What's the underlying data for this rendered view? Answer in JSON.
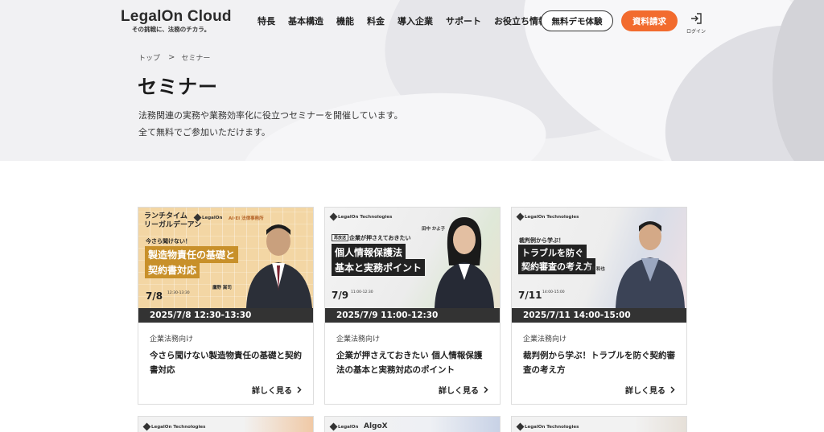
{
  "header": {
    "logo_main": "LegalOn Cloud",
    "logo_tagline": "その挑戦に、法務のチカラ。",
    "nav": [
      "特長",
      "基本構造",
      "機能",
      "料金",
      "導入企業",
      "サポート",
      "お役立ち情報"
    ],
    "demo_button": "無料デモ体験",
    "doc_button": "資料請求",
    "login_label": "ログイン"
  },
  "breadcrumb": {
    "home": "トップ",
    "separator": ">",
    "current": "セミナー"
  },
  "page": {
    "title": "セミナー",
    "desc_line1": "法務関連の実務や業務効率化に役立つセミナーを開催しています。",
    "desc_line2": "全て無料でご参加いただけます。"
  },
  "cards": [
    {
      "date": "2025/7/8 12:30-13:30",
      "category": "企業法務向け",
      "title": "今さら聞けない製造物責任の基礎と契約書対応",
      "more": "詳しく見る",
      "thumb": {
        "series": "ランチタイム\nリーガルデーアン",
        "logo": "LegalOn",
        "partner": "AI·EI 法律事務所",
        "lead": "今さら聞けない！",
        "line1": "製造物責任の基礎と",
        "line2": "契約書対応",
        "date": "7/8",
        "time": "12:30-13:30",
        "speaker": "鷹野 嵩司"
      }
    },
    {
      "date": "2025/7/9 11:00-12:30",
      "category": "企業法務向け",
      "title": "企業が押さえておきたい 個人情報保護法の基本と実務対応のポイント",
      "more": "詳しく見る",
      "thumb": {
        "logo": "LegalOn Technologies",
        "tag": "再放送",
        "lead": "企業が押さえておきたい",
        "line1": "個人情報保護法",
        "line2": "基本と実務ポイント",
        "date": "7/9",
        "time": "11:00-12:30",
        "speaker": "田中 かよ子"
      }
    },
    {
      "date": "2025/7/11 14:00-15:00",
      "category": "企業法務向け",
      "title": "裁判例から学ぶ！トラブルを防ぐ契約審査の考え方",
      "more": "詳しく見る",
      "thumb": {
        "logo": "LegalOn Technologies",
        "lead": "裁判例から学ぶ！",
        "line1": "トラブルを防ぐ",
        "line2": "契約審査の考え方",
        "date": "7/11",
        "time": "14:00-15:00",
        "speaker": "高澤 和也"
      }
    }
  ],
  "next_row": [
    {
      "logo": "LegalOn Technologies"
    },
    {
      "logo": "LegalOn",
      "partner": "AlgoX"
    },
    {
      "logo": "LegalOn Technologies"
    }
  ],
  "colors": {
    "accent": "#f26b2e",
    "date_bar": "#333333",
    "card1_bg": "#f4d8a8",
    "card1_accent": "#c8902a"
  }
}
